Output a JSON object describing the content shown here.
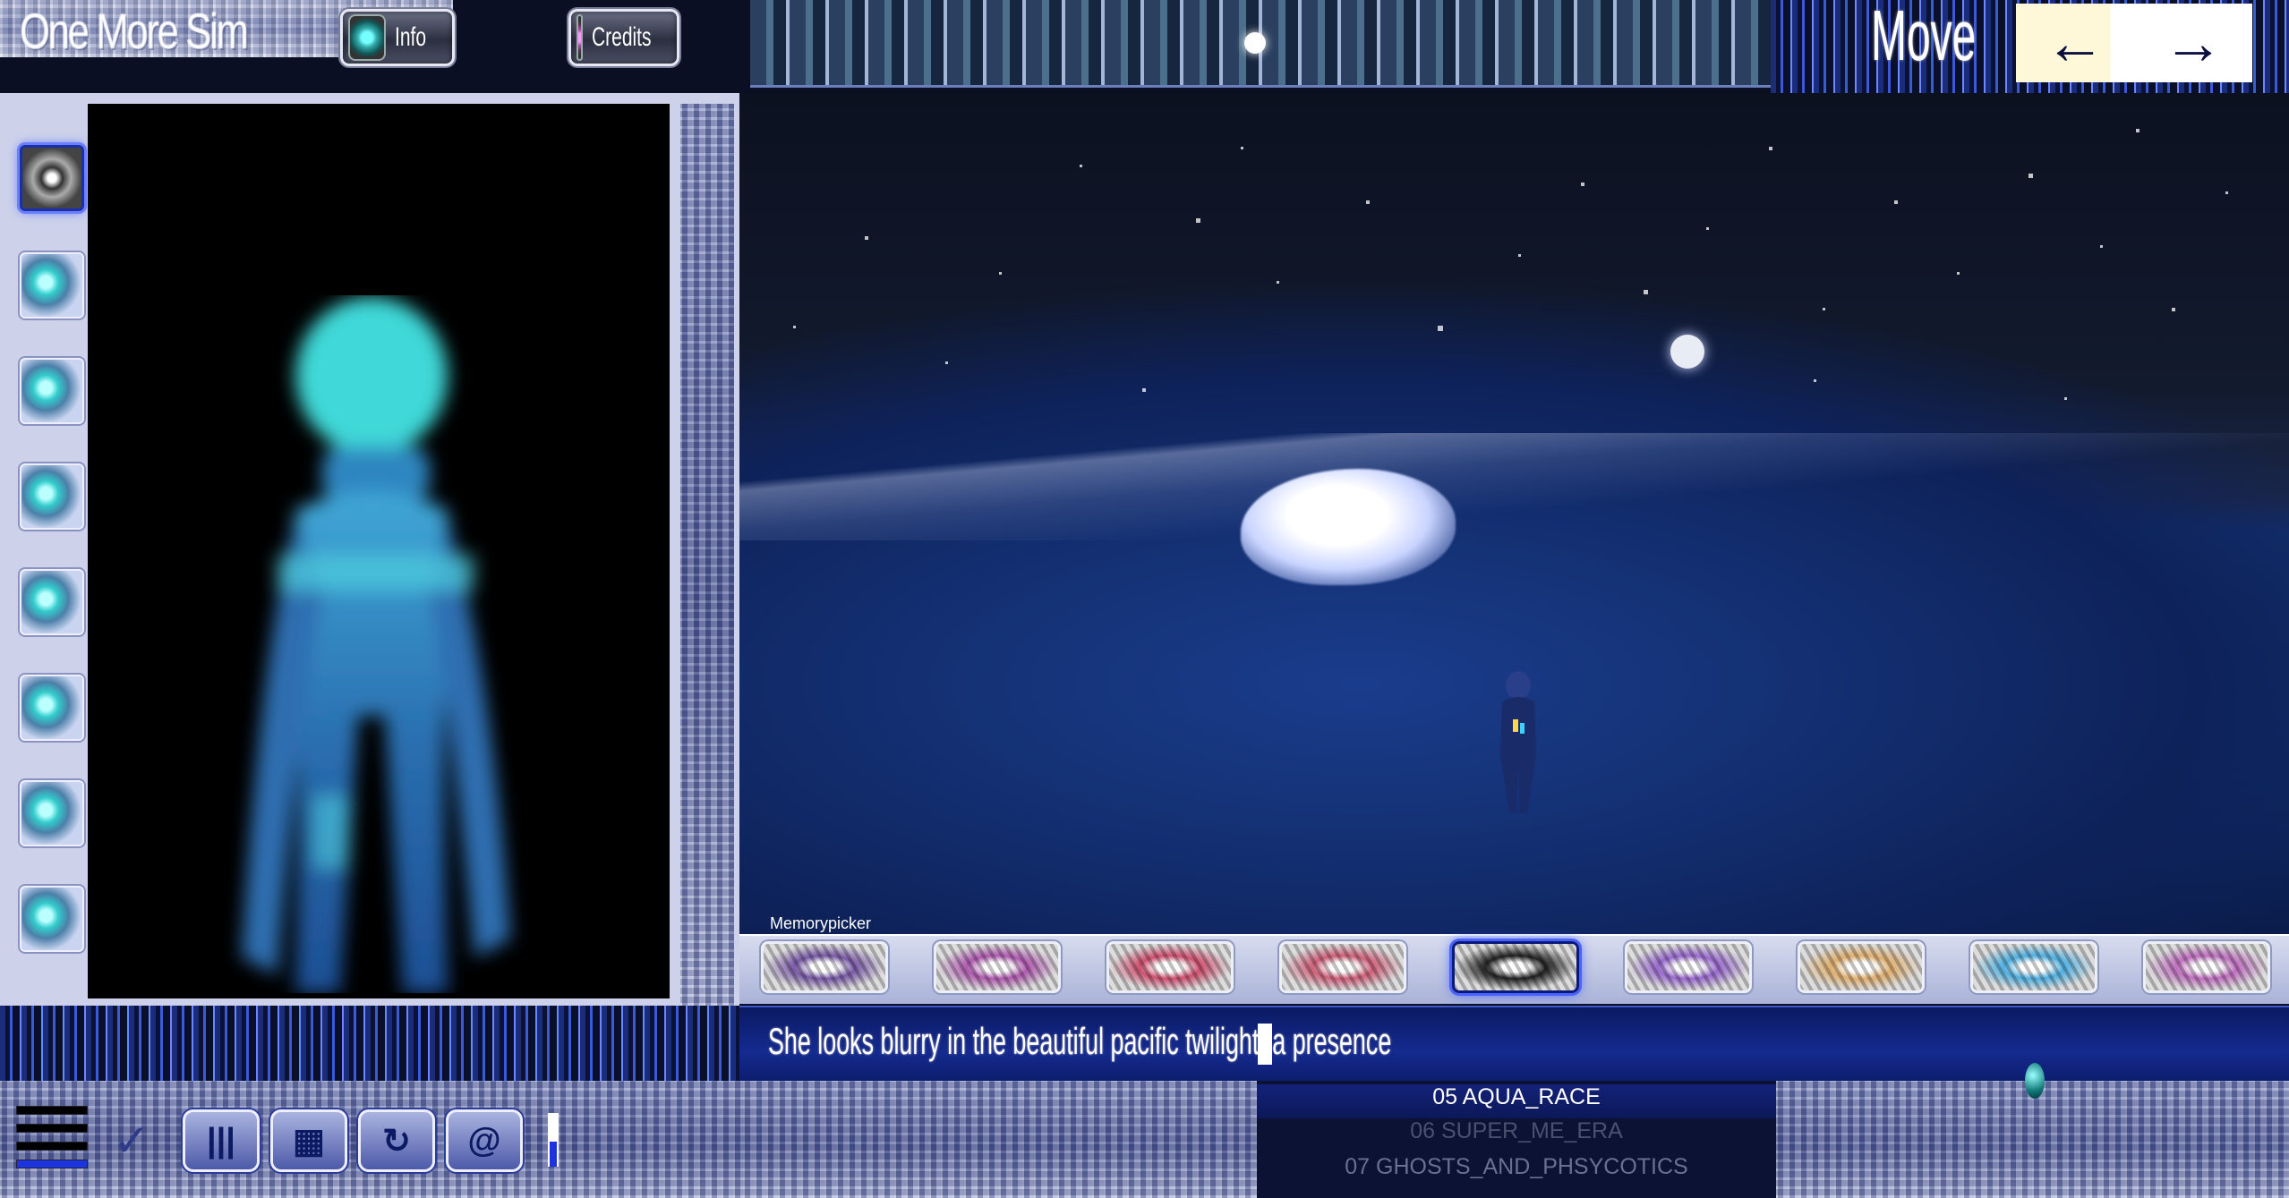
{
  "header": {
    "title": "One More Sim",
    "info_label": "Info",
    "credits_label": "Credits",
    "move_label": "Move",
    "move_left": "←",
    "move_right": "→"
  },
  "outfits": {
    "selected_index": 0,
    "items": [
      "outfit-1",
      "outfit-2",
      "outfit-3",
      "outfit-4",
      "outfit-5",
      "outfit-6",
      "outfit-7",
      "outfit-8"
    ]
  },
  "memorypicker": {
    "label": "Memorypicker",
    "selected_index": 4,
    "items": [
      {
        "color": "#7a5aa8"
      },
      {
        "color": "#b05ab0"
      },
      {
        "color": "#d05070"
      },
      {
        "color": "#d0607a"
      },
      {
        "color": "#222222"
      },
      {
        "color": "#9a6ad0"
      },
      {
        "color": "#e0b070"
      },
      {
        "color": "#50b0e0"
      },
      {
        "color": "#c070c0"
      }
    ]
  },
  "subtitle": {
    "text": "She looks blurry in the beautiful pacific twilight, a presence"
  },
  "playlist": {
    "current": "05 AQUA_RACE",
    "next": "06 SUPER_ME_ERA",
    "after": "07 GHOSTS_AND_PHSYCOTICS"
  },
  "toolbar": {
    "tools": [
      "equalizer-icon",
      "grid-icon",
      "refresh-icon",
      "spiral-icon"
    ],
    "check_glyph": "✓"
  },
  "colors": {
    "accent": "#1c34e0",
    "panel": "#cdd2ea",
    "deep_blue": "#0b1a62"
  }
}
